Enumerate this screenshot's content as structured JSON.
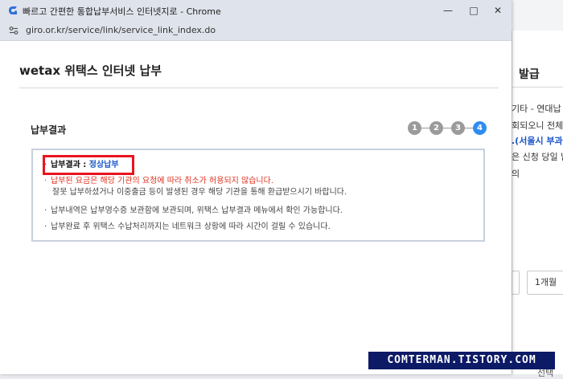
{
  "window": {
    "title": "빠르고 간편한 통합납부서비스 인터넷지로 - Chrome",
    "url": "giro.or.kr/service/link/service_link_index.do",
    "minimize_icon": "minimize-icon",
    "maximize_icon": "maximize-icon",
    "close_icon": "close-icon"
  },
  "popup": {
    "header_title": "wetax 위택스 인터넷 납부",
    "section_title": "납부결과",
    "steps": [
      "1",
      "2",
      "3",
      "4"
    ],
    "active_step": 4,
    "result": {
      "label": "납부결과 : ",
      "value": "정상납부"
    },
    "notices": [
      {
        "line1": "납부된 요금은 해당 기관의 요청에 따라 취소가 허용되지 않습니다.",
        "line2": "잘못 납부하셨거나 이중출금 등이 발생된 경우 해당 기관을 통해 환급받으시기 바랍니다."
      },
      {
        "line1": "납부내역은 납부영수증 보관함에 보관되며, 위택스 납부결과 메뉴에서 확인 가능합니다."
      },
      {
        "line1": "납부완료 후 위택스 수납처리까지는 네트워크 상황에 따라 시간이 걸릴 수 있습니다."
      }
    ],
    "colors": {
      "accent": "#2f8df0",
      "highlight_border": "#e8141f",
      "warning_text": "#e0301e",
      "result_value": "#1a56c7"
    }
  },
  "background": {
    "title": "발급",
    "lines": [
      "기타 - 연대납",
      "회되오니 전체",
      ".(서울시 부과",
      "은 신청 당일 납",
      "의"
    ],
    "button_right": "1개월",
    "bottom_text": "선택"
  },
  "watermark": "COMTERMAN.TISTORY.COM"
}
